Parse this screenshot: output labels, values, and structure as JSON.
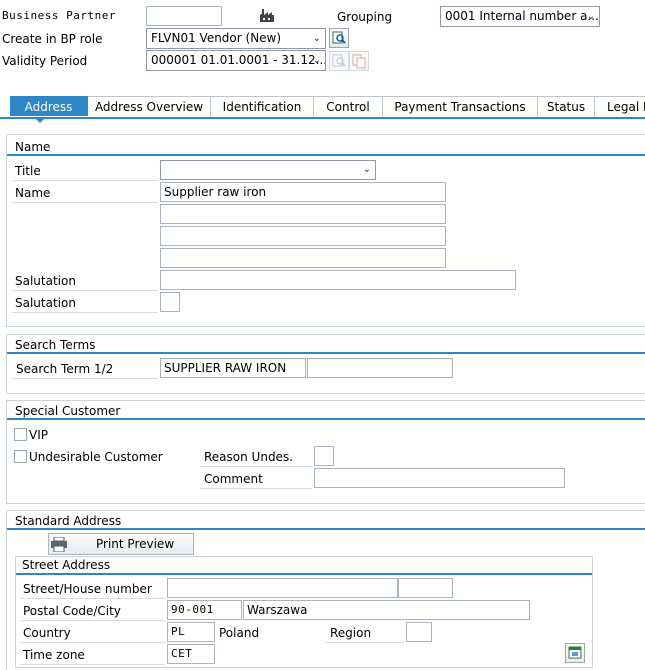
{
  "header": {
    "business_partner_label": "Business Partner",
    "business_partner_value": "",
    "grouping_label": "Grouping",
    "grouping_value": "0001 Internal number a...",
    "create_role_label": "Create in BP role",
    "create_role_value": "FLVN01 Vendor (New)",
    "validity_label": "Validity Period",
    "validity_value": "000001 01.01.0001 - 31.12..."
  },
  "tabs": [
    {
      "label": "Address",
      "active": true
    },
    {
      "label": "Address Overview"
    },
    {
      "label": "Identification"
    },
    {
      "label": "Control"
    },
    {
      "label": "Payment Transactions"
    },
    {
      "label": "Status"
    },
    {
      "label": "Legal D"
    }
  ],
  "name_section": {
    "title": "Name",
    "title_label": "Title",
    "title_value": "",
    "name_label": "Name",
    "name_line1": "Supplier raw iron",
    "name_line2": "",
    "name_line3": "",
    "name_line4": "",
    "salutation_label": "Salutation",
    "salutation_value": "",
    "salutation2_label": "Salutation",
    "salutation2_value": ""
  },
  "search_section": {
    "title": "Search Terms",
    "term_label": "Search Term 1/2",
    "term1": "SUPPLIER RAW IRON",
    "term2": ""
  },
  "special_section": {
    "title": "Special Customer",
    "vip_label": "VIP",
    "undesirable_label": "Undesirable Customer",
    "reason_label": "Reason Undes.",
    "reason_value": "",
    "comment_label": "Comment",
    "comment_value": ""
  },
  "standard_address": {
    "title": "Standard Address",
    "print_preview_label": "Print Preview",
    "street_address_title": "Street Address",
    "street_label": "Street/House number",
    "street_value": "",
    "house_value": "",
    "postal_label": "Postal Code/City",
    "postal_value": "90-001",
    "city_value": "Warszawa",
    "country_label": "Country",
    "country_code": "PL",
    "country_name": "Poland",
    "region_label": "Region",
    "region_value": "",
    "timezone_label": "Time zone",
    "timezone_value": "CET"
  },
  "colors": {
    "accent": "#2d86c6",
    "border": "#a9b3bd"
  },
  "icons": [
    "factory-icon",
    "find-icon",
    "copy-icon",
    "print-icon",
    "timezone-icon"
  ]
}
